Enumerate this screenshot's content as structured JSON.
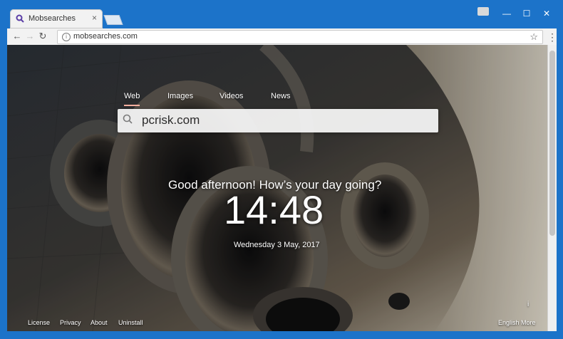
{
  "browser": {
    "tab_title": "Mobsearches",
    "tab_close": "×",
    "url": "mobsearches.com",
    "window_controls": [
      "—",
      "☐",
      "✕"
    ]
  },
  "search": {
    "tabs": [
      "Web",
      "Images",
      "Videos",
      "News"
    ],
    "active_tab": "Web",
    "query": "pcrisk.com"
  },
  "clock": {
    "greeting": "Good afternoon! How’s your day going?",
    "time": "14:48",
    "date": "Wednesday 3 May, 2017"
  },
  "footer": {
    "links": [
      "License",
      "Privacy",
      "About",
      "Uninstall"
    ],
    "language": "English",
    "more": "More",
    "info": "i"
  }
}
